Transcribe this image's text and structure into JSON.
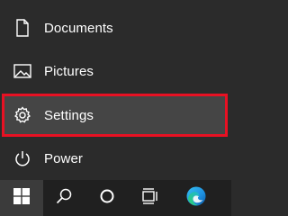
{
  "start_menu": {
    "items": [
      {
        "label": "Documents",
        "icon": "document-icon"
      },
      {
        "label": "Pictures",
        "icon": "pictures-icon"
      },
      {
        "label": "Settings",
        "icon": "gear-icon",
        "highlighted": true
      },
      {
        "label": "Power",
        "icon": "power-icon"
      }
    ]
  },
  "taskbar": {
    "buttons": [
      {
        "icon": "windows-logo-icon"
      },
      {
        "icon": "search-icon"
      },
      {
        "icon": "cortana-icon"
      },
      {
        "icon": "task-view-icon"
      },
      {
        "icon": "edge-icon"
      }
    ]
  },
  "colors": {
    "menu_bg": "#2b2b2b",
    "taskbar_bg": "#202020",
    "highlight_bg": "#454545",
    "highlight_border": "#e81123",
    "text": "#ffffff"
  }
}
